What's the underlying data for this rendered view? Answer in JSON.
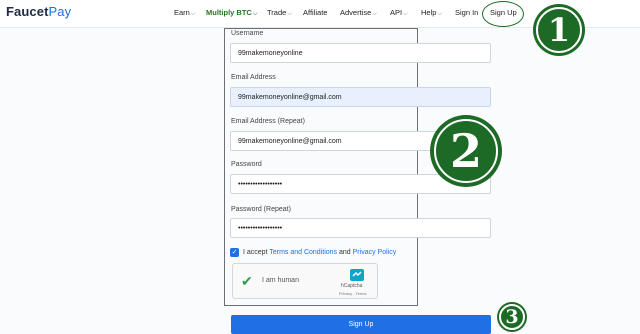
{
  "header": {
    "logo_main": "Faucet",
    "logo_accent": "Pay",
    "nav": [
      {
        "label": "Earn",
        "chevron": "⌵"
      },
      {
        "label": "Multiply BTC",
        "chevron": "⌵"
      },
      {
        "label": "Trade",
        "chevron": "⌵"
      },
      {
        "label": "Affiliate"
      },
      {
        "label": "Advertise",
        "chevron": "⌵"
      },
      {
        "label": "API",
        "chevron": "⌵"
      },
      {
        "label": "Help",
        "chevron": "⌵"
      },
      {
        "label": "Sign In"
      },
      {
        "label": "Sign Up"
      }
    ]
  },
  "form": {
    "username_label": "Username",
    "username_value": "99makemoneyonline",
    "email_label": "Email Address",
    "email_value": "99makemoneyonline@gmail.com",
    "email_repeat_label": "Email Address (Repeat)",
    "email_repeat_value": "99makemoneyonline@gmail.com",
    "password_label": "Password",
    "password_value": "••••••••••••••••••",
    "password_repeat_label": "Password (Repeat)",
    "password_repeat_value": "••••••••••••••••••",
    "accept_prefix": "I accept",
    "terms_link": "Terms and Conditions",
    "accept_and": "and",
    "privacy_link": "Privacy Policy",
    "submit_label": "Sign Up"
  },
  "captcha": {
    "checkmark": "✔",
    "label": "I am human",
    "brand": "hCaptcha",
    "terms": "Privacy - Terms"
  },
  "annotations": {
    "step1": "1",
    "step2": "2",
    "step3": "3"
  },
  "colors": {
    "accent": "#1f6fe5",
    "annotation_green": "#1c6a25",
    "captcha_check": "#2e9b45"
  },
  "icons": {
    "chevron": "chevron-down-icon",
    "checkbox": "checkbox-checked-icon",
    "captcha_check": "check-icon",
    "captcha_logo": "hcaptcha-logo-icon"
  }
}
